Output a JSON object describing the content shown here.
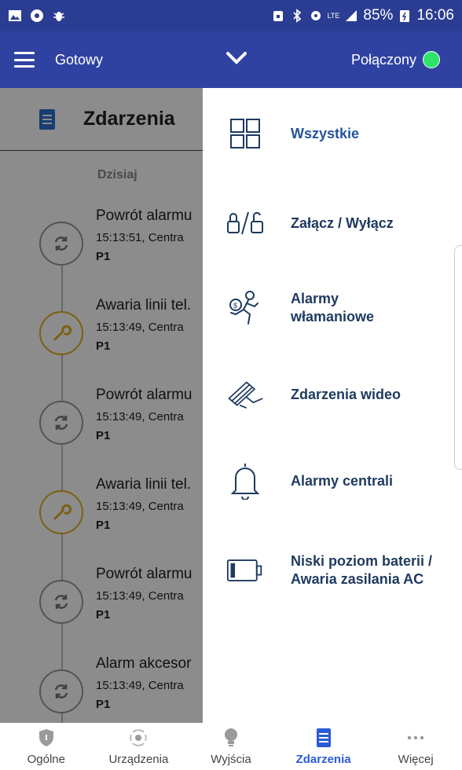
{
  "status_bar": {
    "battery": "85%",
    "time": "16:06",
    "network": "LTE"
  },
  "app_bar": {
    "title": "Gotowy",
    "connection": "Połączony",
    "connection_color": "#2ee36a"
  },
  "events_section": {
    "title": "Zdarzenia",
    "day_label": "Dzisiaj",
    "events": [
      {
        "title": "Powrót alarmu",
        "meta": "15:13:51, Centra",
        "partition": "P1",
        "icon": "refresh-icon"
      },
      {
        "title": "Awaria linii tel.",
        "meta": "15:13:49, Centra",
        "partition": "P1",
        "icon": "wrench-icon"
      },
      {
        "title": "Powrót alarmu",
        "meta": "15:13:49, Centra",
        "partition": "P1",
        "icon": "refresh-icon"
      },
      {
        "title": "Awaria linii tel.",
        "meta": "15:13:49, Centra",
        "partition": "P1",
        "icon": "wrench-icon"
      },
      {
        "title": "Powrót alarmu",
        "meta": "15:13:49, Centra",
        "partition": "P1",
        "icon": "refresh-icon"
      },
      {
        "title": "Alarm akcesor",
        "meta": "15:13:49, Centra",
        "partition": "P1",
        "icon": "refresh-icon"
      }
    ]
  },
  "filter_menu": {
    "items": [
      {
        "label": "Wszystkie",
        "icon": "grid-icon"
      },
      {
        "label": "Załącz / Wyłącz",
        "icon": "lock-unlock-icon"
      },
      {
        "label": "Alarmy włamaniowe",
        "icon": "burglar-icon"
      },
      {
        "label": "Zdarzenia wideo",
        "icon": "camera-icon"
      },
      {
        "label": "Alarmy centrali",
        "icon": "bell-icon"
      },
      {
        "label": "Niski poziom baterii / Awaria zasilania AC",
        "icon": "battery-icon"
      }
    ]
  },
  "bottom_nav": {
    "items": [
      {
        "label": "Ogólne",
        "icon": "shield-icon"
      },
      {
        "label": "Urządzenia",
        "icon": "devices-icon"
      },
      {
        "label": "Wyjścia",
        "icon": "bulb-icon"
      },
      {
        "label": "Zdarzenia",
        "icon": "events-icon"
      },
      {
        "label": "Więcej",
        "icon": "more-icon"
      }
    ]
  },
  "colors": {
    "primary": "#3042a1",
    "status_bar": "#2b3d92",
    "active_nav": "#2a5bd7",
    "menu_text": "#1e3a5f"
  }
}
